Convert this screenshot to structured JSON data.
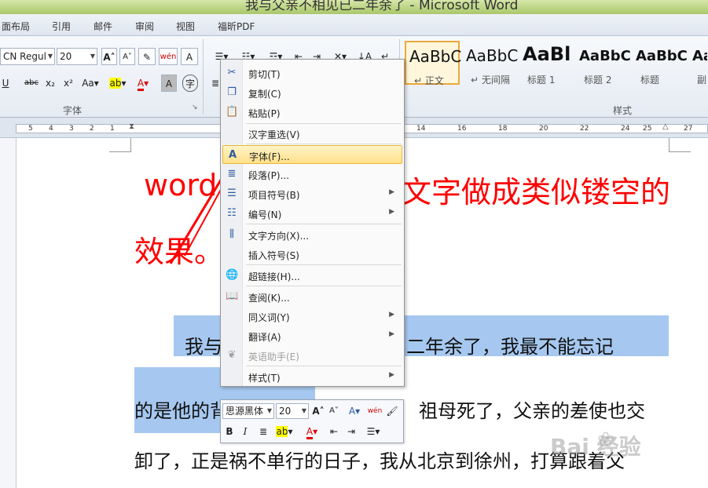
{
  "window": {
    "title": "我与父亲不相见已二年余了 - Microsoft Word"
  },
  "tabs": [
    "面布局",
    "引用",
    "邮件",
    "审阅",
    "视图",
    "福昕PDF"
  ],
  "ribbon": {
    "font_name": "CN Regul",
    "font_size": "20",
    "font_group_label": "字体",
    "styles_group_label": "样式",
    "styles": [
      {
        "preview": "AaBbC",
        "name": "正文"
      },
      {
        "preview": "AaBbC",
        "name": "无间隔"
      },
      {
        "preview": "AaBl",
        "name": "标题 1"
      },
      {
        "preview": "AaBbC",
        "name": "标题 2"
      },
      {
        "preview": "AaBbC",
        "name": "标题"
      },
      {
        "preview": "Aa",
        "name": "副"
      }
    ]
  },
  "ruler": {
    "numbers": [
      "5",
      "4",
      "3",
      "2",
      "1",
      "14",
      "16",
      "18",
      "20",
      "22",
      "24",
      "25",
      "27"
    ]
  },
  "document": {
    "heading_part1": "word",
    "heading_part2": "文字做成类似镂空的",
    "heading_part3": "效果。",
    "line1_a": "我与",
    "line1_b": "二年余了，我最不能忘记",
    "line2_a": "的是他的背影",
    "line2_b": "祖母死了，父亲的差使也交",
    "line3": "卸了，正是祸不单行的日子，我从北京到徐州，打算跟着父"
  },
  "context_menu": {
    "items": [
      {
        "label": "剪切(T)",
        "icon": "scissors-icon"
      },
      {
        "label": "复制(C)",
        "icon": "copy-icon"
      },
      {
        "label": "粘贴(P)",
        "icon": "paste-icon"
      },
      {
        "label": "汉字重选(V)",
        "icon": ""
      },
      {
        "label": "字体(F)...",
        "icon": "font-icon"
      },
      {
        "label": "段落(P)...",
        "icon": "paragraph-icon"
      },
      {
        "label": "项目符号(B)",
        "icon": "bullets-icon"
      },
      {
        "label": "编号(N)",
        "icon": "numbering-icon"
      },
      {
        "label": "文字方向(X)...",
        "icon": "text-direction-icon"
      },
      {
        "label": "插入符号(S)",
        "icon": ""
      },
      {
        "label": "超链接(H)...",
        "icon": "hyperlink-icon"
      },
      {
        "label": "查阅(K)...",
        "icon": "research-icon"
      },
      {
        "label": "同义词(Y)",
        "icon": ""
      },
      {
        "label": "翻译(A)",
        "icon": ""
      },
      {
        "label": "英语助手(E)",
        "icon": "english-assistant-icon"
      },
      {
        "label": "样式(T)",
        "icon": ""
      }
    ]
  },
  "mini_toolbar": {
    "font_name": "思源黑体",
    "font_size": "20"
  },
  "watermark": {
    "text": "Bai 经验"
  }
}
